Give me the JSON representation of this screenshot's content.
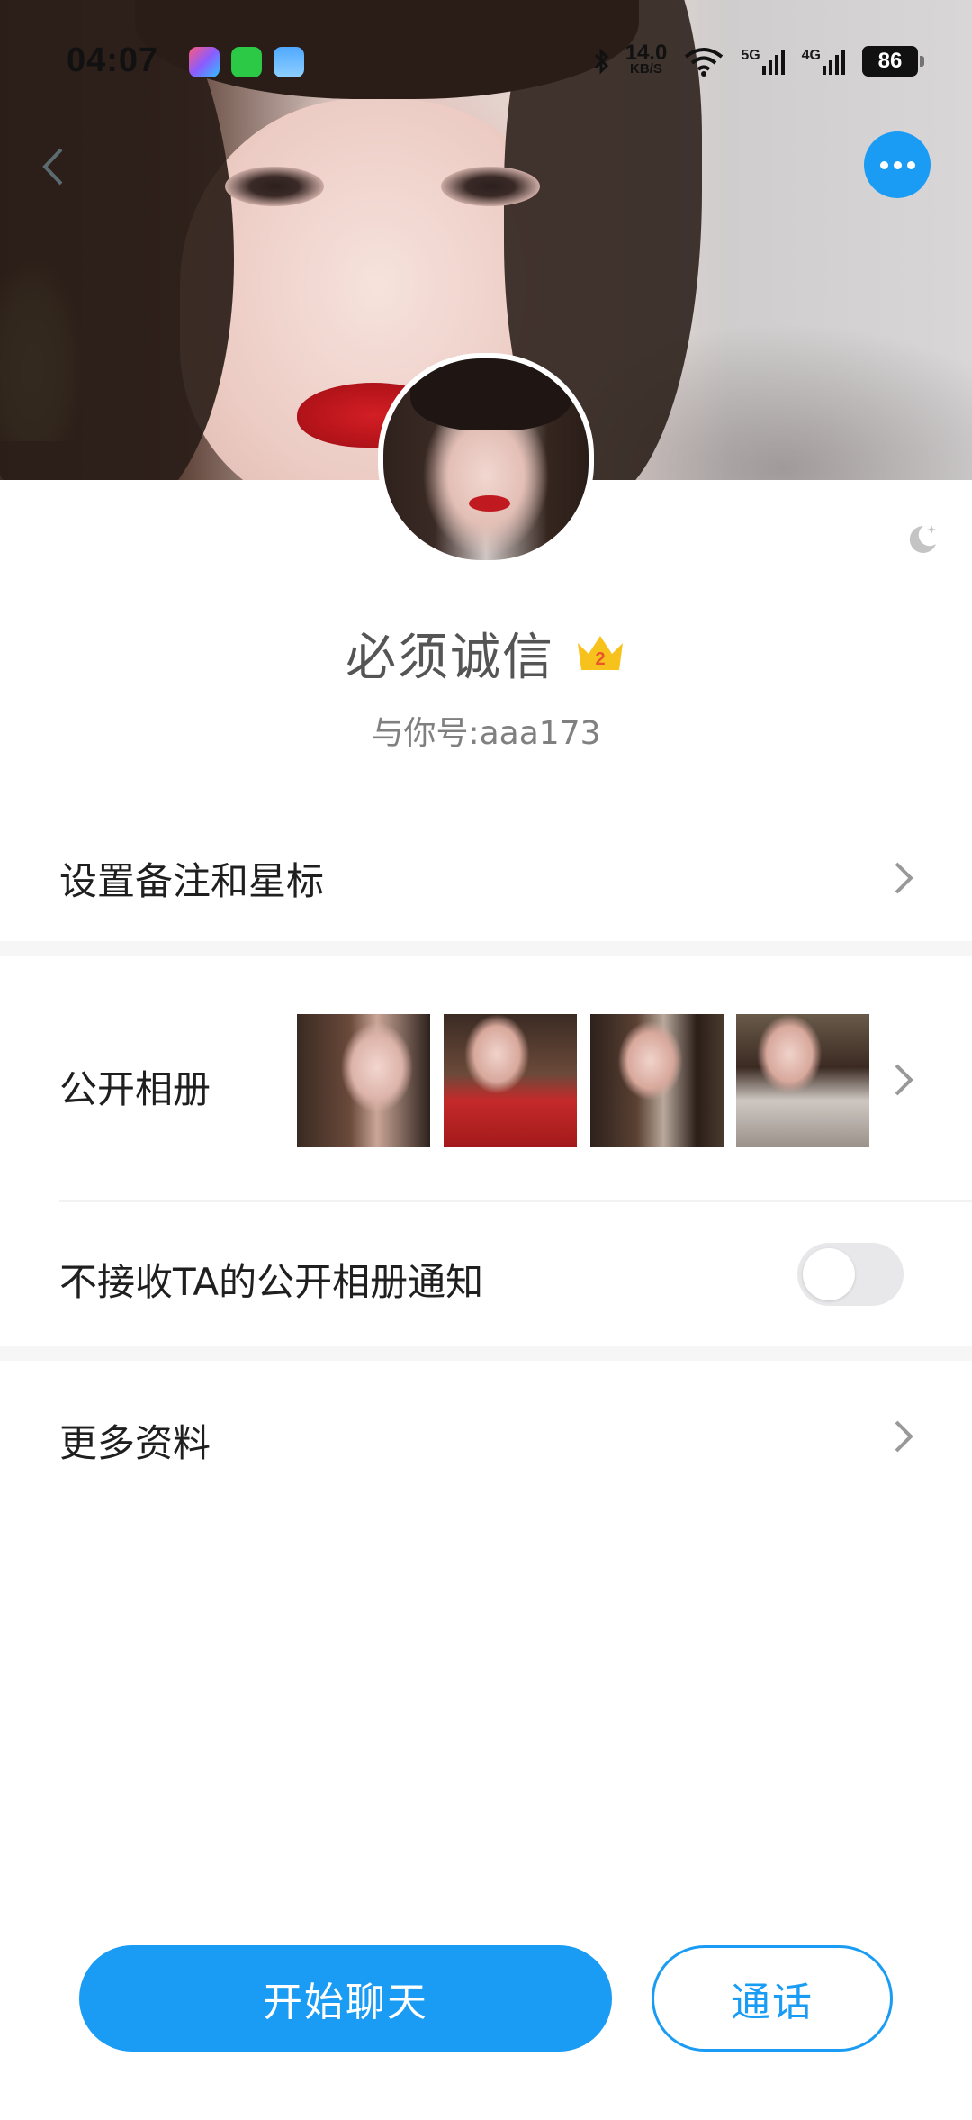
{
  "status_bar": {
    "time": "04:07",
    "net_speed_value": "14.0",
    "net_speed_unit": "KB/S",
    "signal1": "5G",
    "signal2": "4G",
    "battery": "86"
  },
  "icons": {
    "back": "back-icon",
    "more": "more-icon",
    "night": "night-mode-icon",
    "crown": "vip-crown-icon",
    "chevron": "chevron-right-icon"
  },
  "profile": {
    "name": "必须诚信",
    "vip_level": "2",
    "account": "与你号:aaa173"
  },
  "rows": {
    "remark": "设置备注和星标",
    "album": "公开相册",
    "album_notice": "不接收TA的公开相册通知",
    "more_info": "更多资料"
  },
  "toggle_album_notice": false,
  "buttons": {
    "chat": "开始聊天",
    "call": "通话"
  },
  "colors": {
    "accent": "#1a9cf5",
    "text_primary": "#1f1f1f",
    "text_secondary": "#808080"
  }
}
